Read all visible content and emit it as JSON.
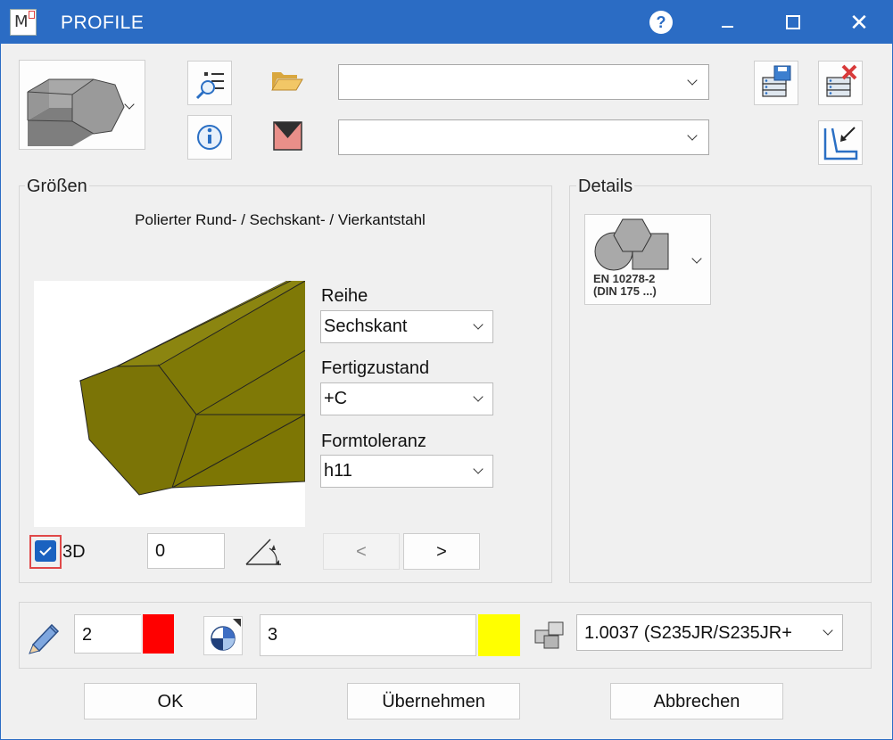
{
  "window": {
    "title": "PROFILE",
    "app_icon_letter": "M"
  },
  "toolbar": {
    "help_glyph": "?"
  },
  "top_combos": {
    "first_value": "",
    "second_value": ""
  },
  "groups": {
    "sizes_label": "Größen",
    "details_label": "Details"
  },
  "description": "Polierter Rund- / Sechskant- / Vierkantstahl",
  "fields": {
    "reihe_label": "Reihe",
    "reihe_value": "Sechskant",
    "fertig_label": "Fertigzustand",
    "fertig_value": "+C",
    "form_label": "Formtoleranz",
    "form_value": "h11"
  },
  "view": {
    "checkbox_3d_label": "3D",
    "checkbox_3d_checked": true,
    "angle_value": "0"
  },
  "nav": {
    "prev_label": "<",
    "next_label": ">"
  },
  "details_card": {
    "line1": "EN 10278-2",
    "line2": "(DIN 175 ...)"
  },
  "bottom": {
    "pen_value": "2",
    "pen_color": "#ff0000",
    "layer_value": "3",
    "layer_color": "#ffff00",
    "material_value": "1.0037 (S235JR/S235JR+"
  },
  "actions": {
    "ok_label": "OK",
    "apply_label": "Übernehmen",
    "cancel_label": "Abbrechen"
  },
  "colors": {
    "titlebar": "#2b6cc4",
    "steel_face": "#8f8810",
    "steel_side": "#7d7604"
  }
}
